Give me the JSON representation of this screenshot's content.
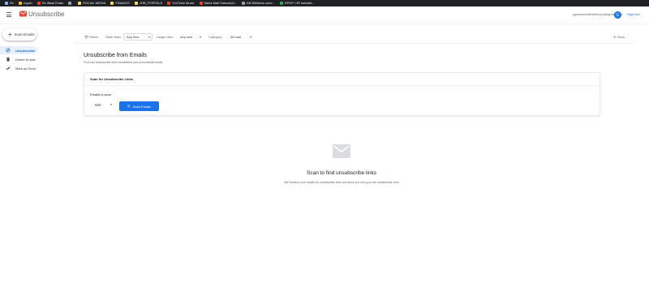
{
  "bookmarks": [
    {
      "label": "Rz",
      "color": "#8ab4f8"
    },
    {
      "label": "crypto",
      "color": "#fbbc04"
    },
    {
      "label": "Rs Ittisal Evals",
      "color": "#ea4335"
    },
    {
      "label": "",
      "color": "#9aa0a6"
    },
    {
      "label": "SOCIAL MEDIA",
      "color": "#fdd663"
    },
    {
      "label": "FINANCE",
      "color": "#fdd663"
    },
    {
      "label": "JOB_PORTALS",
      "color": "#fdd663"
    },
    {
      "label": "YouTube Music",
      "color": "#ea4335"
    },
    {
      "label": "Sales Mail Subscripti...",
      "color": "#ea4335"
    },
    {
      "label": "Kill Bill/trans.com/...",
      "color": "#9aa0a6"
    },
    {
      "label": "DPDP: HR website...",
      "color": "#34a853"
    }
  ],
  "header": {
    "app_title": "Unsubscribe",
    "email": "pgsmenutorfreeforyou@gmail.com",
    "avatar_letter": "G",
    "signout_label": "Sign Out"
  },
  "sidebar": {
    "scan_button_label": "Scan Emails",
    "items": [
      {
        "label": "Unsubscribe",
        "icon": "unlink-icon",
        "active": true
      },
      {
        "label": "Delete Emails",
        "icon": "trash-icon",
        "active": false
      },
      {
        "label": "Mark as Read",
        "icon": "done-all-icon",
        "active": false
      }
    ]
  },
  "filters": {
    "label": "Filters",
    "older_than_label": "Older than",
    "older_than_value": "Any time",
    "larger_than_label": "Larger than",
    "larger_than_value": "Any size",
    "category_label": "Category",
    "category_value": "All mail",
    "clear_label": "Clear"
  },
  "main": {
    "title": "Unsubscribe from Emails",
    "subtitle": "Find and unsubscribe from newsletters and promotional emails",
    "card_title": "Scan for Unsubscribe Links",
    "emails_to_scan_label": "Emails to scan",
    "emails_to_scan_value": "500",
    "scan_button_label": "Scan Emails"
  },
  "empty_state": {
    "icon": "mail-icon",
    "title": "Scan to find unsubscribe links",
    "description": "We'll search your emails for unsubscribe links and show you who you can unsubscribe from"
  },
  "colors": {
    "accent": "#1a73e8",
    "logo_red": "#ea4335",
    "active_bg": "#e8f0fe"
  }
}
